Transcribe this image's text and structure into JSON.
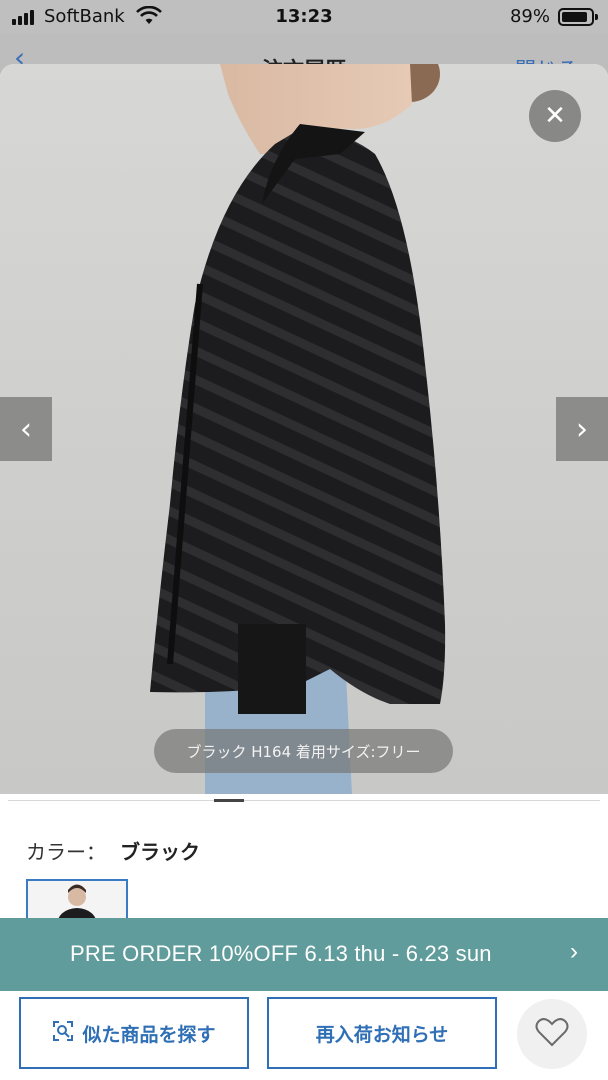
{
  "status_bar": {
    "carrier": "SoftBank",
    "time": "13:23",
    "battery": "89%",
    "battery_level": 0.89
  },
  "background_nav": {
    "back_icon": "chevron-left-icon",
    "title": "注文履歴",
    "close_label": "閉じる"
  },
  "gallery": {
    "caption": "ブラック H164 着用サイズ:フリー",
    "close_icon": "close-icon",
    "prev_icon": "chevron-left-icon",
    "next_icon": "chevron-right-icon",
    "close_glyph": "✕",
    "prev_glyph": "‹",
    "next_glyph": "›"
  },
  "product": {
    "color_label": "カラー：",
    "color_value": "ブラック"
  },
  "promo": {
    "text": "PRE ORDER 10%OFF 6.13 thu - 6.23 sun",
    "chevron": "›",
    "bg_color": "#609c9b"
  },
  "actions": {
    "similar_label": "似た商品を探す",
    "restock_label": "再入荷お知らせ",
    "favorite_icon": "heart-icon",
    "accent_color": "#2f6fb5"
  }
}
